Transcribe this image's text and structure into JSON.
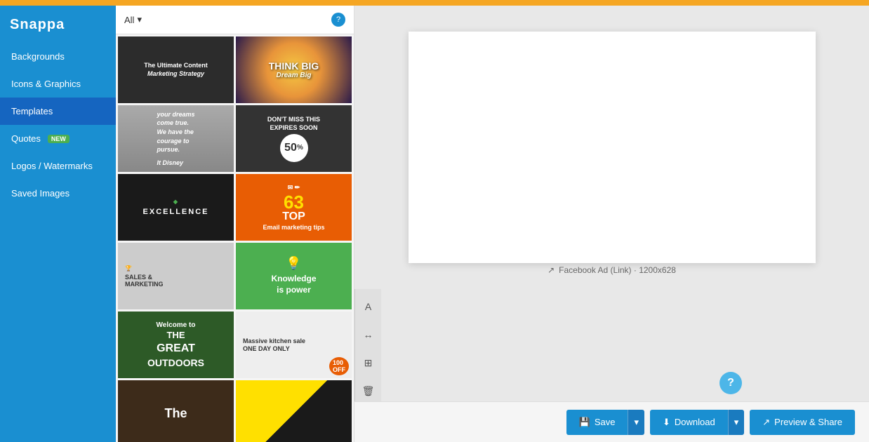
{
  "topBar": {},
  "sidebar": {
    "logo": "Snappa",
    "items": [
      {
        "label": "Backgrounds",
        "active": false
      },
      {
        "label": "Icons & Graphics",
        "active": false
      },
      {
        "label": "Templates",
        "active": true
      },
      {
        "label": "Quotes",
        "active": false,
        "badge": "NEW"
      },
      {
        "label": "Logos / Watermarks",
        "active": false
      },
      {
        "label": "Saved Images",
        "active": false
      }
    ]
  },
  "gallery": {
    "filter": "All",
    "helpTitle": "Help",
    "templates": [
      {
        "label": "The Ultimate Content Marketing Strategy",
        "style": "dark-marketing"
      },
      {
        "label": "THINK BIG Dream Big",
        "style": "think-big"
      },
      {
        "label": "It Disney",
        "style": "walt"
      },
      {
        "label": "50% EXPIRES SOON",
        "style": "50off"
      },
      {
        "label": "EXCELLENCE",
        "style": "excellence"
      },
      {
        "label": "63 TOP Email marketing tips",
        "style": "63top"
      },
      {
        "label": "SALES & MARKETING",
        "style": "sales"
      },
      {
        "label": "Knowledge is power",
        "style": "knowledge"
      },
      {
        "label": "Welcome to THE GREAT OUTDOORS",
        "style": "great-outdoors"
      },
      {
        "label": "Massive kitchen sale ONE DAY ONLY",
        "style": "kitchen"
      },
      {
        "label": "The",
        "style": "the"
      },
      {
        "label": "",
        "style": "yellow"
      }
    ]
  },
  "canvas": {
    "label": "Facebook Ad (Link) · 1200x628"
  },
  "toolbar": {
    "icons": [
      "A",
      "↔",
      "⊞",
      "🗑"
    ]
  },
  "bottomBar": {
    "saveLabel": "Save",
    "downloadLabel": "Download",
    "previewLabel": "Preview & Share",
    "helpLabel": "?"
  }
}
